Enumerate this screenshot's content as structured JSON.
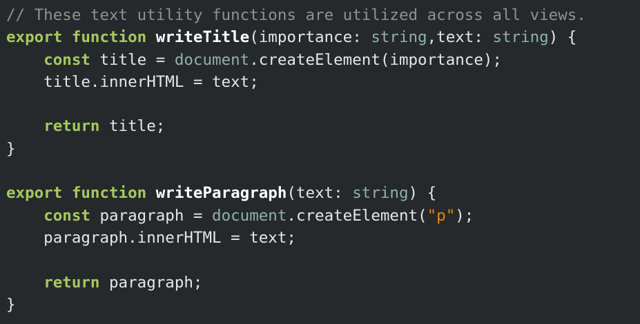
{
  "colors": {
    "background": "#26292b",
    "comment": "#8f9192",
    "keyword": "#a6c95f",
    "function_name": "#ffffff",
    "type": "#8fb3a5",
    "string": "#e7860f",
    "plain": "#e6e6e6"
  },
  "code": {
    "lines": [
      {
        "tokens": [
          {
            "t": "comment",
            "text": "// These text utility functions are utilized across all views."
          }
        ]
      },
      {
        "tokens": [
          {
            "t": "keyword",
            "text": "export"
          },
          {
            "t": "plain",
            "text": " "
          },
          {
            "t": "keyword",
            "text": "function"
          },
          {
            "t": "plain",
            "text": " "
          },
          {
            "t": "funcname",
            "text": "writeTitle"
          },
          {
            "t": "plain",
            "text": "(importance: "
          },
          {
            "t": "type",
            "text": "string"
          },
          {
            "t": "plain",
            "text": ",text: "
          },
          {
            "t": "type",
            "text": "string"
          },
          {
            "t": "plain",
            "text": ") {"
          }
        ]
      },
      {
        "tokens": [
          {
            "t": "plain",
            "text": "    "
          },
          {
            "t": "keyword",
            "text": "const"
          },
          {
            "t": "plain",
            "text": " title = "
          },
          {
            "t": "builtin",
            "text": "document"
          },
          {
            "t": "plain",
            "text": ".createElement(importance);"
          }
        ]
      },
      {
        "tokens": [
          {
            "t": "plain",
            "text": "    title.innerHTML = text;"
          }
        ]
      },
      {
        "tokens": []
      },
      {
        "tokens": [
          {
            "t": "plain",
            "text": "    "
          },
          {
            "t": "keyword",
            "text": "return"
          },
          {
            "t": "plain",
            "text": " title;"
          }
        ]
      },
      {
        "tokens": [
          {
            "t": "plain",
            "text": "}"
          }
        ]
      },
      {
        "tokens": []
      },
      {
        "tokens": [
          {
            "t": "keyword",
            "text": "export"
          },
          {
            "t": "plain",
            "text": " "
          },
          {
            "t": "keyword",
            "text": "function"
          },
          {
            "t": "plain",
            "text": " "
          },
          {
            "t": "funcname",
            "text": "writeParagraph"
          },
          {
            "t": "plain",
            "text": "(text: "
          },
          {
            "t": "type",
            "text": "string"
          },
          {
            "t": "plain",
            "text": ") {"
          }
        ]
      },
      {
        "tokens": [
          {
            "t": "plain",
            "text": "    "
          },
          {
            "t": "keyword",
            "text": "const"
          },
          {
            "t": "plain",
            "text": " paragraph = "
          },
          {
            "t": "builtin",
            "text": "document"
          },
          {
            "t": "plain",
            "text": ".createElement("
          },
          {
            "t": "string",
            "text": "\"p\""
          },
          {
            "t": "plain",
            "text": ");"
          }
        ]
      },
      {
        "tokens": [
          {
            "t": "plain",
            "text": "    paragraph.innerHTML = text;"
          }
        ]
      },
      {
        "tokens": []
      },
      {
        "tokens": [
          {
            "t": "plain",
            "text": "    "
          },
          {
            "t": "keyword",
            "text": "return"
          },
          {
            "t": "plain",
            "text": " paragraph;"
          }
        ]
      },
      {
        "tokens": [
          {
            "t": "plain",
            "text": "}"
          }
        ]
      }
    ]
  }
}
